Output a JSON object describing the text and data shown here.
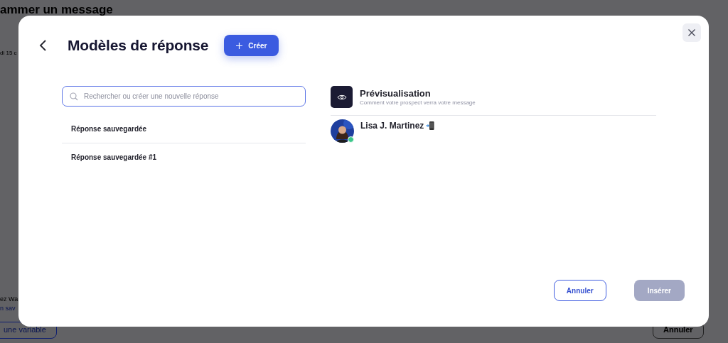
{
  "background": {
    "title": "ammer un message",
    "date": "di 15 c",
    "bottom_text": "ez Wa",
    "bottom_link": "n sav",
    "variable_button": "une variable",
    "cancel_button": "Annuler"
  },
  "modal": {
    "title": "Modèles de réponse",
    "create_button": "Créer",
    "search": {
      "placeholder": "Rechercher ou créer une nouvelle réponse"
    },
    "responses": [
      {
        "label": "Réponse sauvegardée"
      },
      {
        "label": "Réponse sauvegardée #1"
      }
    ],
    "preview": {
      "title": "Prévisualisation",
      "subtitle": "Comment votre prospect verra votre message",
      "contact_name": "Lisa J. Martinez",
      "online": true
    },
    "buttons": [
      {
        "label": "Annuler",
        "kind": "secondary",
        "disabled": false
      },
      {
        "label": "Insérer",
        "kind": "primary",
        "disabled": true
      }
    ]
  }
}
